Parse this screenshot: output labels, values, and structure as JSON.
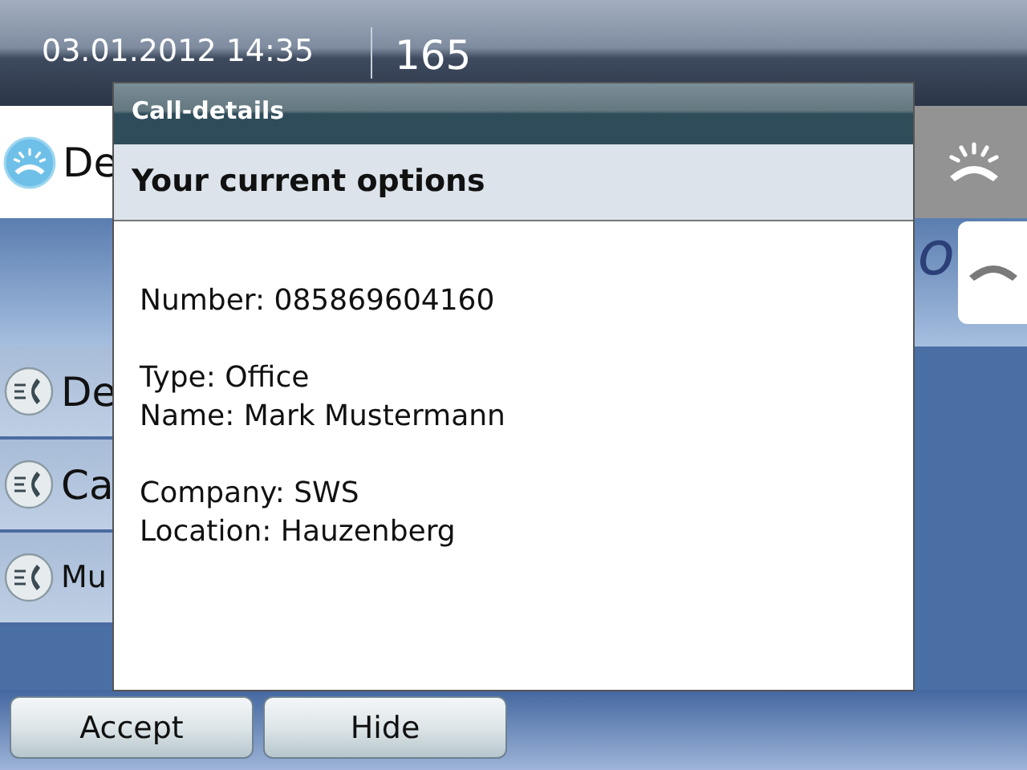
{
  "status_bar": {
    "datetime": "03.01.2012 14:35",
    "extension": "165"
  },
  "incoming_call": {
    "caller": "De"
  },
  "background_label": "o",
  "call_list": [
    {
      "label": "De"
    },
    {
      "label": "Ca"
    },
    {
      "label": "Mu"
    }
  ],
  "dialog": {
    "title": "Call-details",
    "subtitle": "Your current options",
    "details": [
      [
        "Number: 085869604160"
      ],
      [
        "Type: Office",
        "Name: Mark Mustermann"
      ],
      [
        "Company: SWS",
        "Location: Hauzenberg"
      ]
    ]
  },
  "buttons": [
    "Accept",
    "Hide"
  ]
}
